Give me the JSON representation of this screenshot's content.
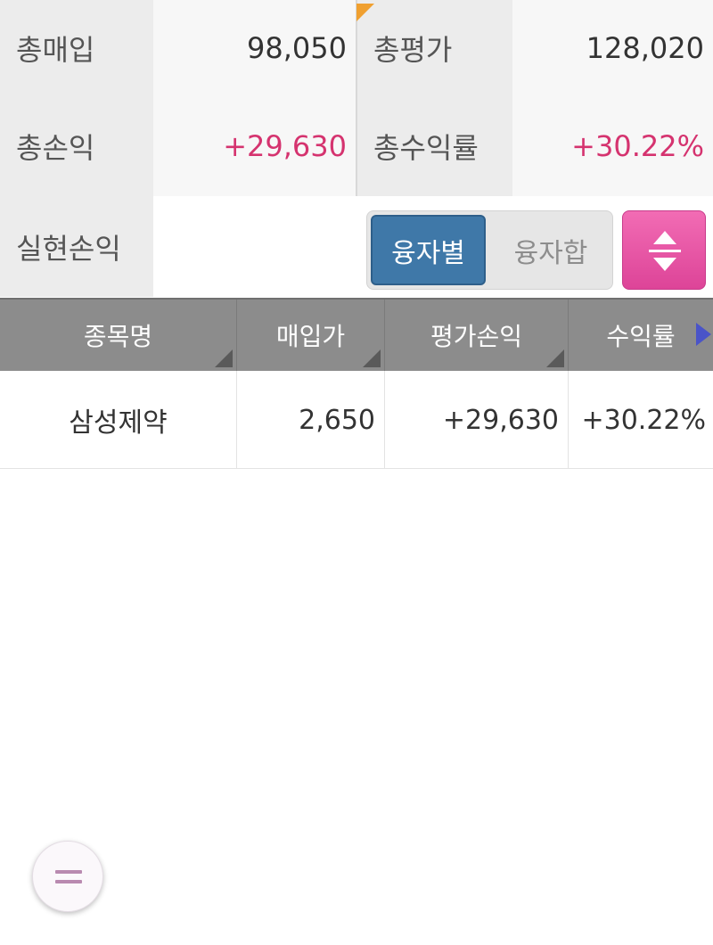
{
  "summary": {
    "total_purchase_label": "총매입",
    "total_purchase_value": "98,050",
    "total_eval_label": "총평가",
    "total_eval_value": "128,020",
    "total_pl_label": "총손익",
    "total_pl_value": "+29,630",
    "total_return_label": "총수익률",
    "total_return_value": "+30.22%",
    "realized_pl_label": "실현손익",
    "realized_pl_value": ""
  },
  "toggle": {
    "by_loan_label": "융자별",
    "loan_sum_label": "융자합",
    "selected": "융자별"
  },
  "table": {
    "headers": [
      "종목명",
      "매입가",
      "평가손익",
      "수익률"
    ],
    "rows": [
      {
        "name": "삼성제약",
        "purchase_price": "2,650",
        "eval_pl": "+29,630",
        "return_rate": "+30.22%"
      }
    ]
  },
  "icons": {
    "sort": "sort-up-down-icon",
    "scroll_right": "right-triangle-icon",
    "menu_fab": "equals-menu-icon",
    "header_sort": "corner-triangle-icon"
  },
  "colors": {
    "positive": "#d5336f",
    "active_toggle": "#3f78a8",
    "sort_button": "#e6509f",
    "header_bg": "#8c8c8c"
  }
}
